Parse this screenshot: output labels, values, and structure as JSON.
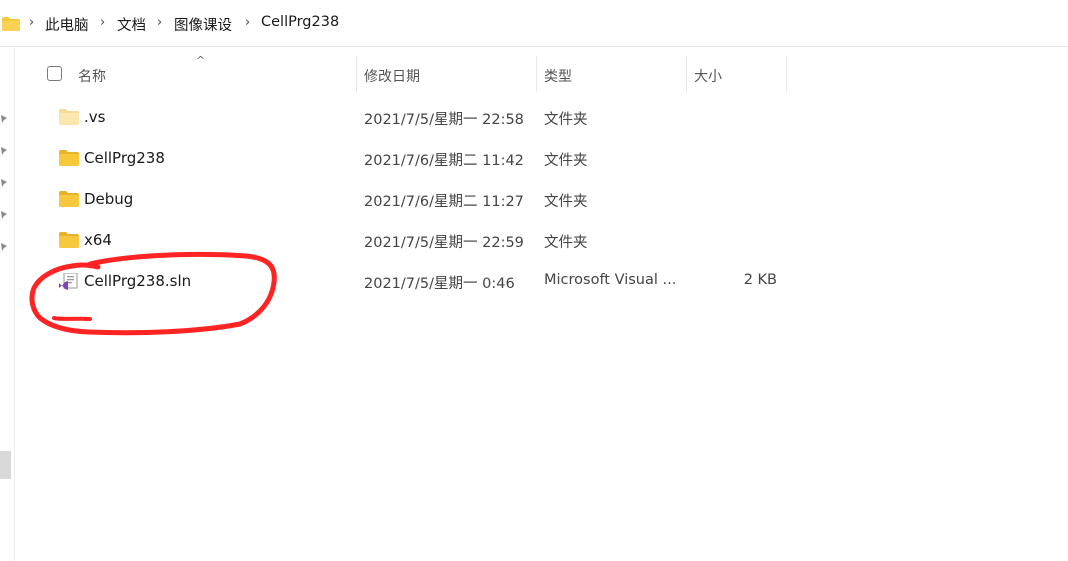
{
  "breadcrumb": {
    "items": [
      "此电脑",
      "文档",
      "图像课设",
      "CellPrg238"
    ],
    "separator": "›"
  },
  "columns": {
    "name": "名称",
    "date": "修改日期",
    "type": "类型",
    "size": "大小",
    "sort_indicator": "^"
  },
  "files": [
    {
      "name": ".vs",
      "date": "2021/7/5/星期一 22:58",
      "type": "文件夹",
      "size": "",
      "icon": "folder-icon",
      "hidden": true
    },
    {
      "name": "CellPrg238",
      "date": "2021/7/6/星期二 11:42",
      "type": "文件夹",
      "size": "",
      "icon": "folder-icon",
      "hidden": false
    },
    {
      "name": "Debug",
      "date": "2021/7/6/星期二 11:27",
      "type": "文件夹",
      "size": "",
      "icon": "folder-icon",
      "hidden": false
    },
    {
      "name": "x64",
      "date": "2021/7/5/星期一 22:59",
      "type": "文件夹",
      "size": "",
      "icon": "folder-icon",
      "hidden": false
    },
    {
      "name": "CellPrg238.sln",
      "date": "2021/7/5/星期一 0:46",
      "type": "Microsoft Visual ...",
      "size": "2 KB",
      "icon": "visual-studio-solution-icon",
      "hidden": false
    }
  ],
  "colors": {
    "folder": "#f8c83c",
    "folder_hidden": "#fbe4a1",
    "annotation": "#ff2424",
    "vs_purple": "#7b45b8"
  }
}
